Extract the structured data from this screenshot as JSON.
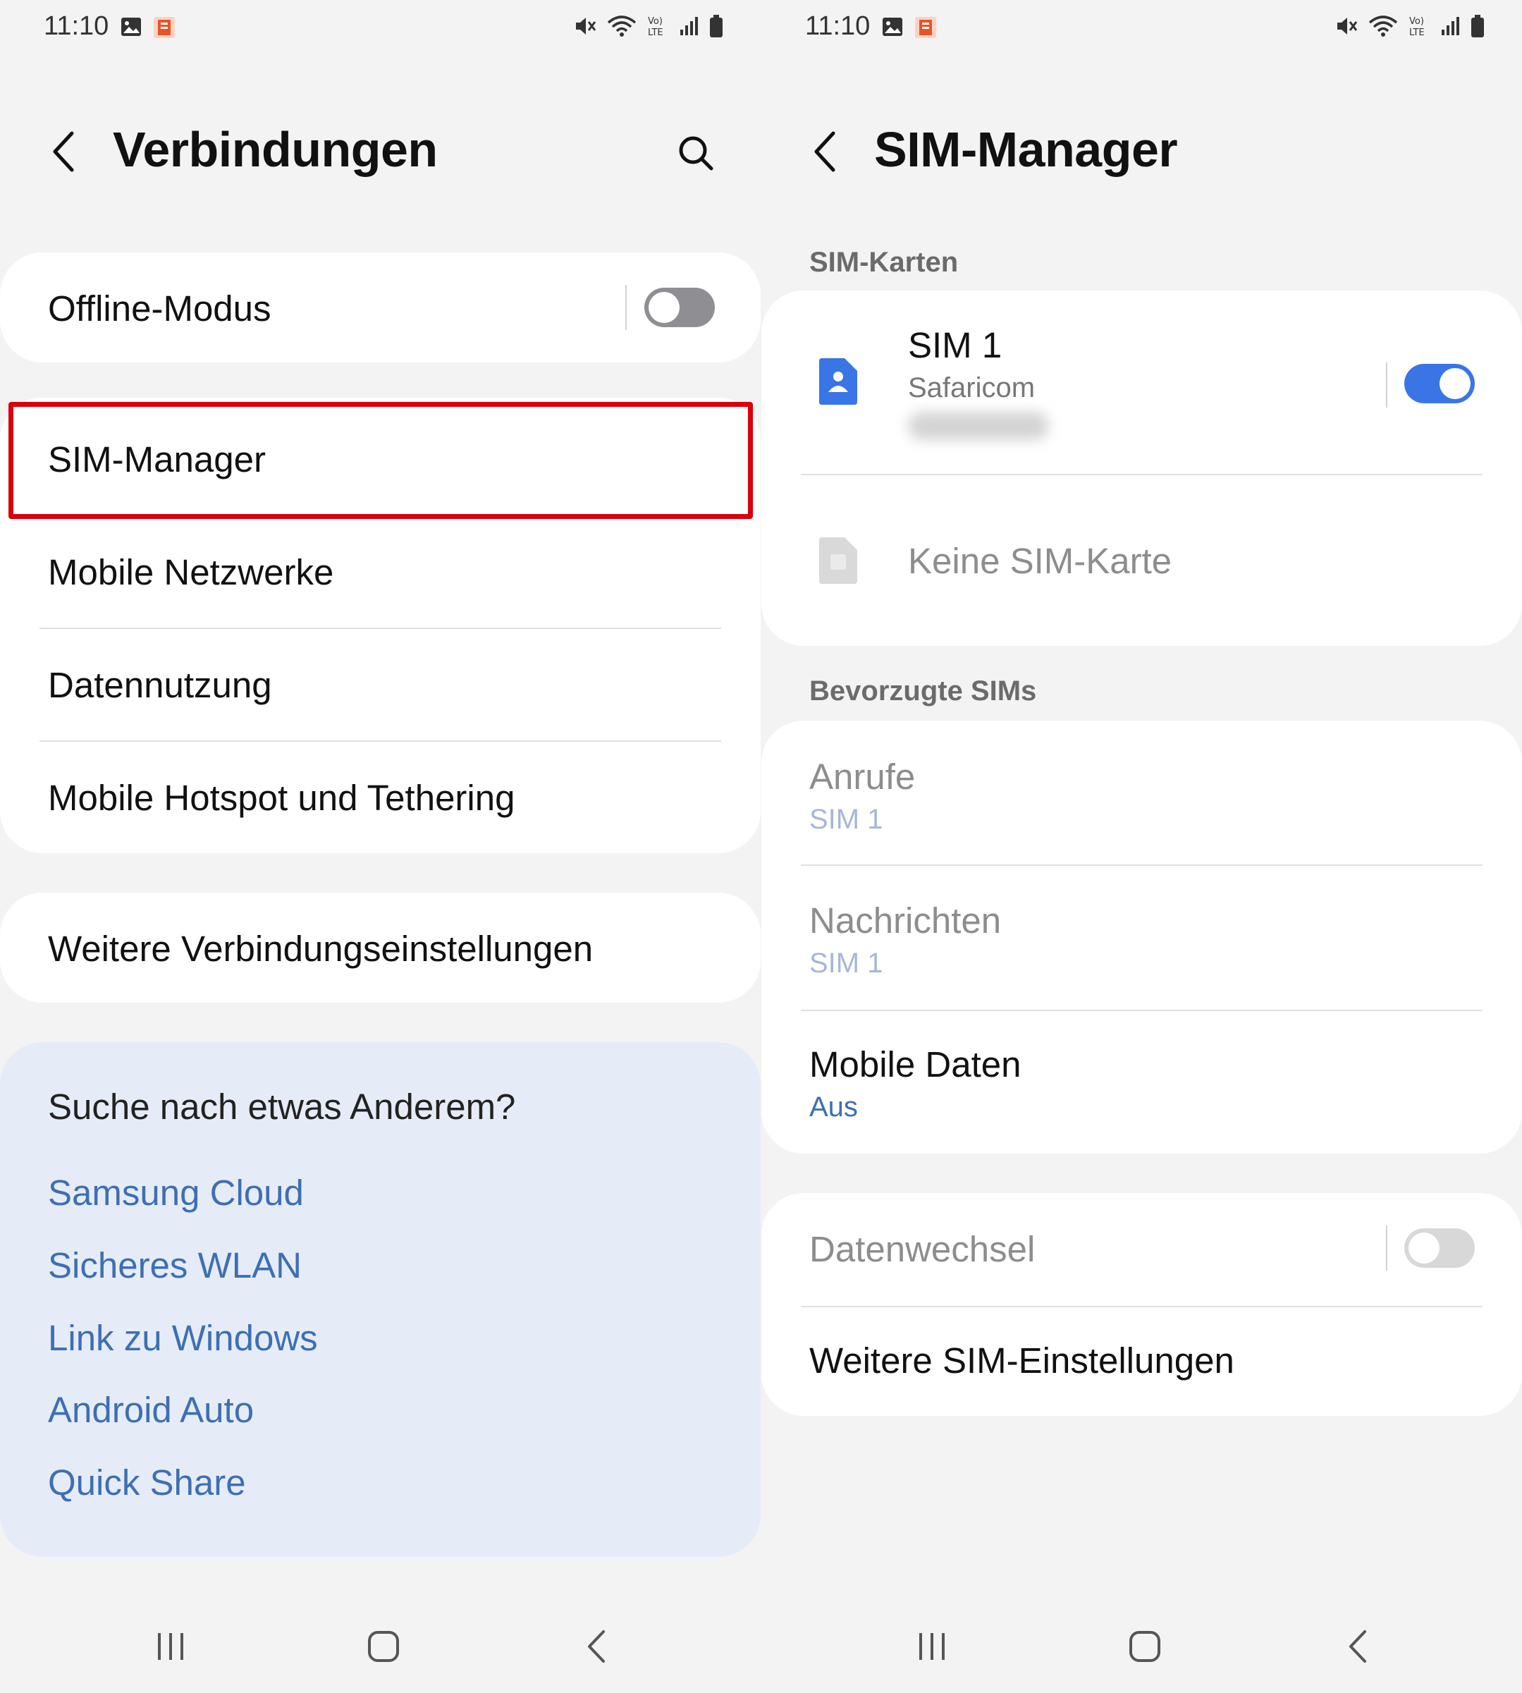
{
  "status_bar": {
    "time": "11:10"
  },
  "left": {
    "title": "Verbindungen",
    "offline_mode": {
      "label": "Offline-Modus",
      "enabled": false
    },
    "items": [
      {
        "label": "SIM-Manager"
      },
      {
        "label": "Mobile Netzwerke"
      },
      {
        "label": "Datennutzung"
      },
      {
        "label": "Mobile Hotspot und Tethering"
      }
    ],
    "more_settings": "Weitere Verbindungseinstellungen",
    "suggestions": {
      "title": "Suche nach etwas Anderem?",
      "links": [
        "Samsung Cloud",
        "Sicheres WLAN",
        "Link zu Windows",
        "Android Auto",
        "Quick Share"
      ]
    }
  },
  "right": {
    "title": "SIM-Manager",
    "sim_cards_header": "SIM-Karten",
    "sim1": {
      "name": "SIM 1",
      "carrier": "Safaricom",
      "enabled": true
    },
    "no_sim": "Keine SIM-Karte",
    "preferred_header": "Bevorzugte SIMs",
    "calls": {
      "label": "Anrufe",
      "value": "SIM 1"
    },
    "messages": {
      "label": "Nachrichten",
      "value": "SIM 1"
    },
    "mobile_data": {
      "label": "Mobile Daten",
      "value": "Aus"
    },
    "data_switch": {
      "label": "Datenwechsel",
      "enabled": false
    },
    "more_sim_settings": "Weitere SIM-Einstellungen"
  },
  "colors": {
    "accent": "#3d6fb4",
    "toggle_on": "#3a75e6",
    "toggle_off": "#8e8e93",
    "highlight": "#d9000b",
    "suggest_bg": "#e6ecf7"
  }
}
